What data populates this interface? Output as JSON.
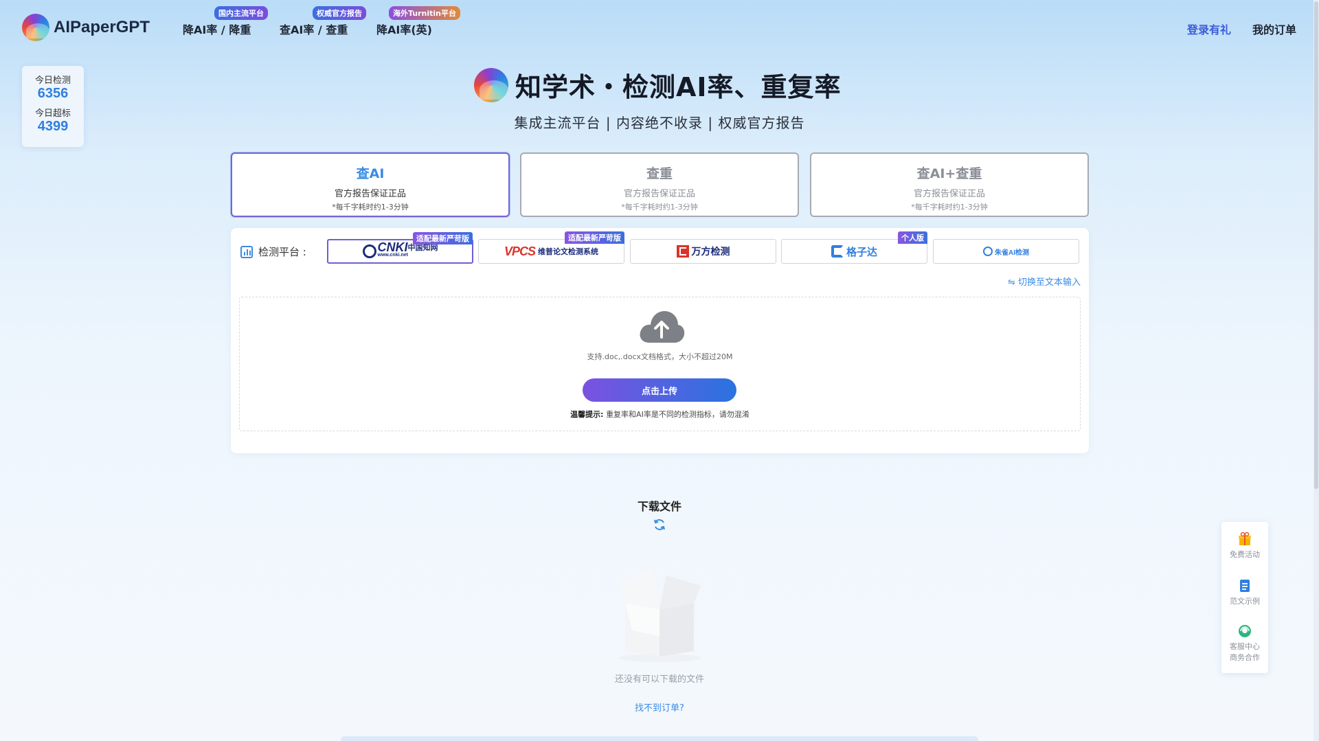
{
  "header": {
    "brand": "AIPaperGPT",
    "nav": [
      {
        "label": "降AI率 / 降重",
        "badge": "国内主流平台"
      },
      {
        "label": "查AI率 / 查重",
        "badge": "权威官方报告"
      },
      {
        "label": "降AI率(英)",
        "badge": "海外Turnitin平台"
      }
    ],
    "login": "登录有礼",
    "orders": "我的订单"
  },
  "stats": {
    "today_check_label": "今日检测",
    "today_check_value": "6356",
    "today_exceed_label": "今日超标",
    "today_exceed_value": "4399"
  },
  "hero": {
    "title": "知学术・检测AI率、重复率",
    "subtitle": "集成主流平台 | 内容绝不收录 | 权威官方报告"
  },
  "modes": [
    {
      "title": "查AI",
      "desc": "官方报告保证正品",
      "note": "*每千字耗时约1-3分钟",
      "active": true
    },
    {
      "title": "查重",
      "desc": "官方报告保证正品",
      "note": "*每千字耗时约1-3分钟",
      "active": false
    },
    {
      "title": "查AI+查重",
      "desc": "官方报告保证正品",
      "note": "*每千字耗时约1-3分钟",
      "active": false
    }
  ],
  "platform": {
    "label": "检测平台 :",
    "items": [
      {
        "name": "CNKI中国知网",
        "logo": "CNKI",
        "sub": "中国知网",
        "url": "www.cnki.net",
        "badge": "适配最新严苛版"
      },
      {
        "name": "VPCS维普论文检测系统",
        "logo": "VPCS",
        "sub": "维普论文检测系统",
        "badge": "适配最新严苛版"
      },
      {
        "name": "万方检测",
        "logo": "万方检测"
      },
      {
        "name": "格子达",
        "logo": "格子达",
        "badge": "个人版"
      },
      {
        "name": "朱雀AI检测",
        "logo": "朱雀AI检测"
      }
    ],
    "switch_text": "⇋ 切换至文本输入"
  },
  "upload": {
    "hint": "支持.doc,.docx文档格式，大小不超过20M",
    "button": "点击上传",
    "tip_label": "温馨提示:",
    "tip_text": "重复率和AI率是不同的检测指标，请勿混淆"
  },
  "download": {
    "title": "下载文件",
    "empty": "还没有可以下载的文件",
    "order_link": "找不到订单?"
  },
  "float_bar": {
    "free": "免费活动",
    "sample": "范文示例",
    "service": "客服中心",
    "business": "商务合作"
  },
  "colors": {
    "accent": "#3a8be3",
    "purple": "#7b52e0",
    "text_dark": "#1f2533"
  }
}
